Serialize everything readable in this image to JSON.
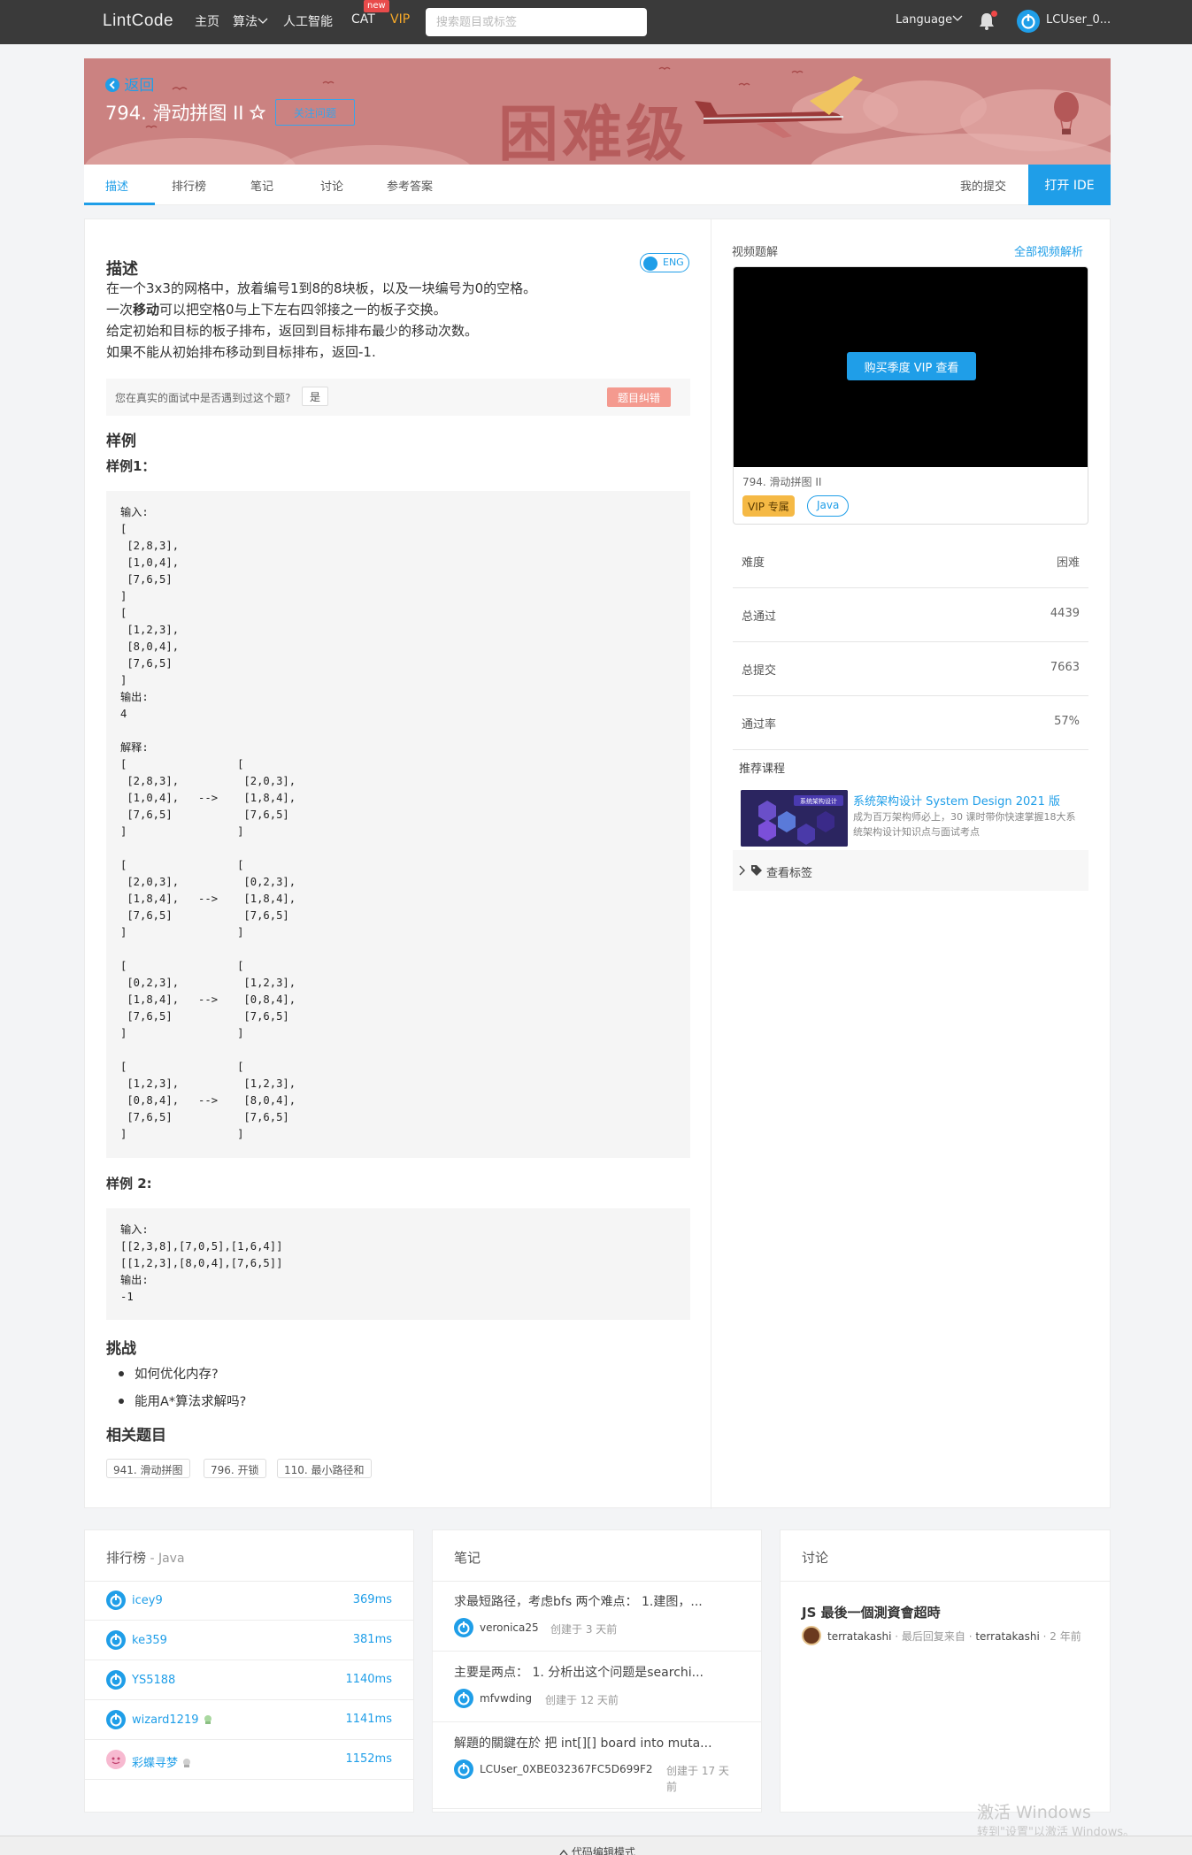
{
  "nav": {
    "logo": "LintCode",
    "items": [
      "主页",
      "算法",
      "人工智能",
      "CAT",
      "VIP"
    ],
    "new_badge": "new",
    "search_placeholder": "搜索题目或标签",
    "language": "Language",
    "user": "LCUser_0..."
  },
  "banner": {
    "back": "返回",
    "title": "794. 滑动拼图 II",
    "follow": "关注问题",
    "difficulty_art": "困难级",
    "color": "#cb8281"
  },
  "tabs": {
    "items": [
      "描述",
      "排行榜",
      "笔记",
      "讨论",
      "参考答案"
    ],
    "my_submissions": "我的提交",
    "open_ide": "打开 IDE"
  },
  "description": {
    "heading": "描述",
    "toggle": "ENG",
    "lines": [
      "在一个3x3的网格中，放着编号1到8的8块板，以及一块编号为0的空格。",
      "一次",
      "可以把空格0与上下左右四邻接之一的板子交换。",
      "给定初始和目标的板子排布，返回到目标排布最少的移动次数。",
      "如果不能从初始排布移动到目标排布，返回-1."
    ],
    "bold_word": "移动",
    "interview_q": "您在真实的面试中是否遇到过这个题?",
    "interview_yes": "是",
    "report_error": "题目纠错"
  },
  "examples": {
    "heading": "样例",
    "ex1_title": "样例1：",
    "ex1_code": "输入:\n[\n [2,8,3],\n [1,0,4],\n [7,6,5]\n]\n[\n [1,2,3],\n [8,0,4],\n [7,6,5]\n]\n输出:\n4\n\n解释:\n[                 [\n [2,8,3],          [2,0,3],\n [1,0,4],   -->    [1,8,4],\n [7,6,5]           [7,6,5]\n]                 ]\n\n[                 [\n [2,0,3],          [0,2,3],\n [1,8,4],   -->    [1,8,4],\n [7,6,5]           [7,6,5]\n]                 ]\n\n[                 [\n [0,2,3],          [1,2,3],\n [1,8,4],   -->    [0,8,4],\n [7,6,5]           [7,6,5]\n]                 ]\n\n[                 [\n [1,2,3],          [1,2,3],\n [0,8,4],   -->    [8,0,4],\n [7,6,5]           [7,6,5]\n]                 ]",
    "ex2_title": "样例 2:",
    "ex2_code": "输入:\n[[2,3,8],[7,0,5],[1,6,4]]\n[[1,2,3],[8,0,4],[7,6,5]]\n输出:\n-1"
  },
  "challenge": {
    "heading": "挑战",
    "items": [
      "如何优化内存?",
      "能用A*算法求解吗?"
    ]
  },
  "related": {
    "heading": "相关题目",
    "items": [
      "941. 滑动拼图",
      "796. 开锁",
      "110. 最小路径和"
    ]
  },
  "sidebar": {
    "video_title": "视频题解",
    "video_link": "全部视频解析",
    "video_button": "购买季度 VIP 查看",
    "video_caption": "794. 滑动拼图 II",
    "vip_tag": "VIP 专属",
    "lang_tag": "Java",
    "stats": [
      {
        "label": "难度",
        "value": "困难"
      },
      {
        "label": "总通过",
        "value": "4439"
      },
      {
        "label": "总提交",
        "value": "7663"
      },
      {
        "label": "通过率",
        "value": "57%"
      }
    ],
    "rec_title": "推荐课程",
    "course_img_label": "系统架构设计",
    "course_name": "系统架构设计 System Design 2021 版",
    "course_desc": "成为百万架构师必上，30 课时带你快速掌握18大系统架构设计知识点与面试考点",
    "view_tags": "查看标签"
  },
  "leaderboard": {
    "title": "排行榜",
    "sub": " - Java",
    "rows": [
      {
        "name": "icey9",
        "time": "369ms"
      },
      {
        "name": "ke359",
        "time": "381ms"
      },
      {
        "name": "YS5188",
        "time": "1140ms"
      },
      {
        "name": "wizard1219",
        "time": "1141ms"
      },
      {
        "name": "彩蝶寻梦",
        "time": "1152ms"
      }
    ]
  },
  "notes": {
    "title": "笔记",
    "items": [
      {
        "text": "求最短路径，考虑bfs 两个难点： 1.建图，...",
        "user": "veronica25",
        "date": "创建于 3 天前"
      },
      {
        "text": "主要是两点： 1. 分析出这个问题是searchi...",
        "user": "mfvwding",
        "date": "创建于 12 天前"
      },
      {
        "text": "解題的關鍵在於 把 int[][] board into muta...",
        "user": "LCUser_0XBE032367FC5D699F2",
        "date": "创建于 17 天",
        "date2": "前"
      }
    ]
  },
  "discussion": {
    "title": "讨论",
    "post_title": "JS 最後一個測資會超時",
    "author": "terratakashi",
    "last_reply": " · 最后回复来自 · ",
    "replier": "terratakashi",
    "ago": " · 2 年前"
  },
  "watermark": {
    "line1": "激活 Windows",
    "line2": "转到\"设置\"以激活 Windows。"
  },
  "bottom_bar": "代码编辑模式"
}
